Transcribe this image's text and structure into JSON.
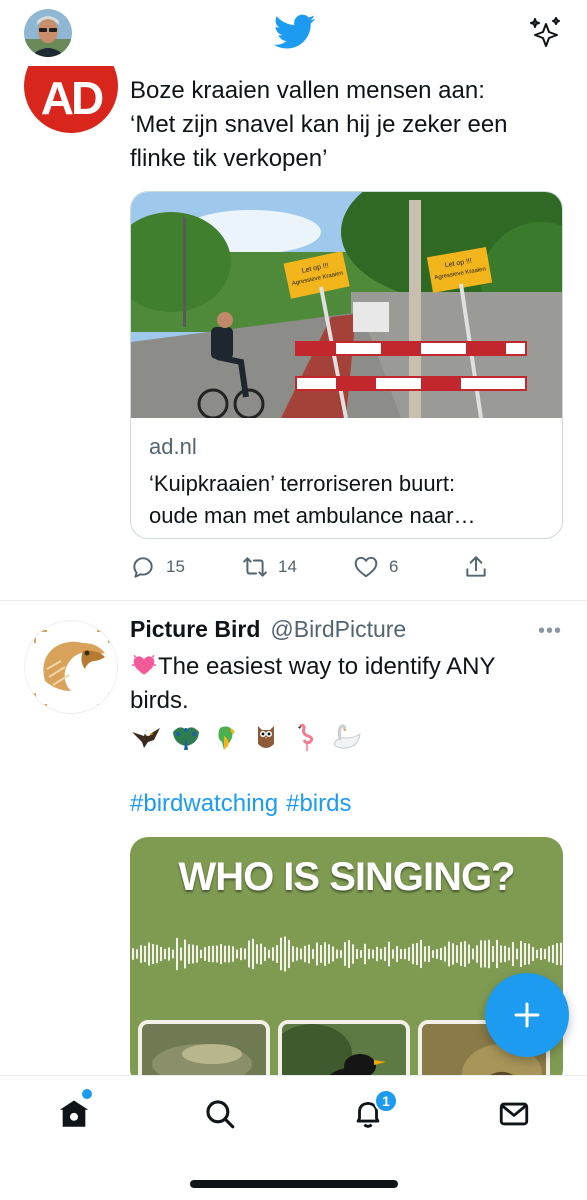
{
  "colors": {
    "brand": "#1d9bf0",
    "text": "#0f1419",
    "secondary": "#536471",
    "ad_red": "#d8261c",
    "media_green": "#7f9b52"
  },
  "header": {
    "logo": "twitter-bird-icon",
    "sparkle": "sparkle-icon"
  },
  "tweet1": {
    "avatar_text": "AD",
    "text_lines": [
      "Boze kraaien vallen mensen aan:",
      "‘Met zijn snavel kan hij je zeker een",
      "flinke tik verkopen’"
    ],
    "card": {
      "sign_text": [
        "Let op !!!",
        "Agressieve Kraaien"
      ],
      "domain": "ad.nl",
      "title_lines": [
        "‘Kuipkraaien’ terroriseren buurt:",
        "oude man met ambulance naar…"
      ]
    },
    "actions": {
      "replies": "15",
      "retweets": "14",
      "likes": "6"
    }
  },
  "tweet2": {
    "display_name": "Picture Bird",
    "handle": "@BirdPicture",
    "more": "•••",
    "text_lines": [
      "The easiest way to identify ANY",
      "birds."
    ],
    "emojis": [
      "eagle",
      "peacock",
      "parrot",
      "owl",
      "flamingo",
      "swan"
    ],
    "hashtags": [
      "#birdwatching",
      "#birds"
    ],
    "media_title": "WHO IS SINGING?"
  },
  "nav": {
    "items": [
      "home-icon",
      "search-icon",
      "notifications-icon",
      "messages-icon"
    ],
    "notification_count": "1"
  }
}
